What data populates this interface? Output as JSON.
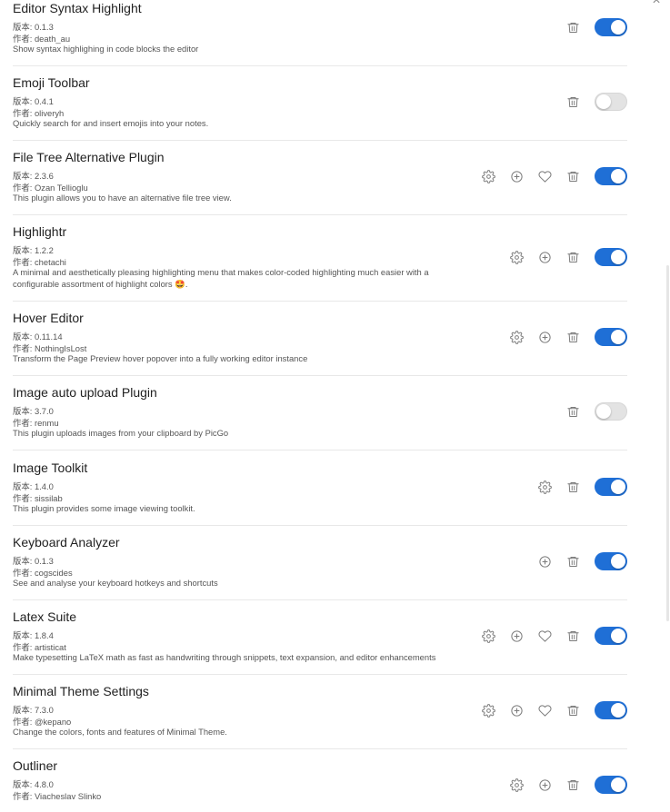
{
  "labels": {
    "version": "版本: ",
    "author": "作者: "
  },
  "plugins": [
    {
      "name": "Editor Syntax Highlight",
      "version": "0.1.3",
      "author": "death_au",
      "description": "Show syntax highlighing in code blocks the editor",
      "actions": [
        "trash"
      ],
      "enabled": true
    },
    {
      "name": "Emoji Toolbar",
      "version": "0.4.1",
      "author": "oliveryh",
      "description": "Quickly search for and insert emojis into your notes.",
      "actions": [
        "trash"
      ],
      "enabled": false
    },
    {
      "name": "File Tree Alternative Plugin",
      "version": "2.3.6",
      "author": "Ozan Tellioglu",
      "description": "This plugin allows you to have an alternative file tree view.",
      "actions": [
        "gear",
        "plus",
        "heart",
        "trash"
      ],
      "enabled": true
    },
    {
      "name": "Highlightr",
      "version": "1.2.2",
      "author": "chetachi",
      "description": "A minimal and aesthetically pleasing highlighting menu that makes color-coded highlighting much easier with a configurable assortment of highlight colors 🤩.",
      "actions": [
        "gear",
        "plus",
        "trash"
      ],
      "enabled": true
    },
    {
      "name": "Hover Editor",
      "version": "0.11.14",
      "author": "NothingIsLost",
      "description": "Transform the Page Preview hover popover into a fully working editor instance",
      "actions": [
        "gear",
        "plus",
        "trash"
      ],
      "enabled": true
    },
    {
      "name": "Image auto upload Plugin",
      "version": "3.7.0",
      "author": "renmu",
      "description": "This plugin uploads images from your clipboard by PicGo",
      "actions": [
        "trash"
      ],
      "enabled": false
    },
    {
      "name": "Image Toolkit",
      "version": "1.4.0",
      "author": "sissilab",
      "description": "This plugin provides some image viewing toolkit.",
      "actions": [
        "gear",
        "trash"
      ],
      "enabled": true
    },
    {
      "name": "Keyboard Analyzer",
      "version": "0.1.3",
      "author": "cogscides",
      "description": "See and analyse your keyboard hotkeys and shortcuts",
      "actions": [
        "plus",
        "trash"
      ],
      "enabled": true
    },
    {
      "name": "Latex Suite",
      "version": "1.8.4",
      "author": "artisticat",
      "description": "Make typesetting LaTeX math as fast as handwriting through snippets, text expansion, and editor enhancements",
      "actions": [
        "gear",
        "plus",
        "heart",
        "trash"
      ],
      "enabled": true
    },
    {
      "name": "Minimal Theme Settings",
      "version": "7.3.0",
      "author": "@kepano",
      "description": "Change the colors, fonts and features of Minimal Theme.",
      "actions": [
        "gear",
        "plus",
        "heart",
        "trash"
      ],
      "enabled": true
    },
    {
      "name": "Outliner",
      "version": "4.8.0",
      "author": "Viacheslav Slinko",
      "description": "",
      "actions": [
        "gear",
        "plus",
        "trash"
      ],
      "enabled": true
    }
  ],
  "close_glyph": "×",
  "colors": {
    "toggle_on": "#1f6fd6",
    "toggle_off": "#e3e3e3",
    "icon": "#7b7b7b",
    "divider": "#e8e8e8"
  }
}
